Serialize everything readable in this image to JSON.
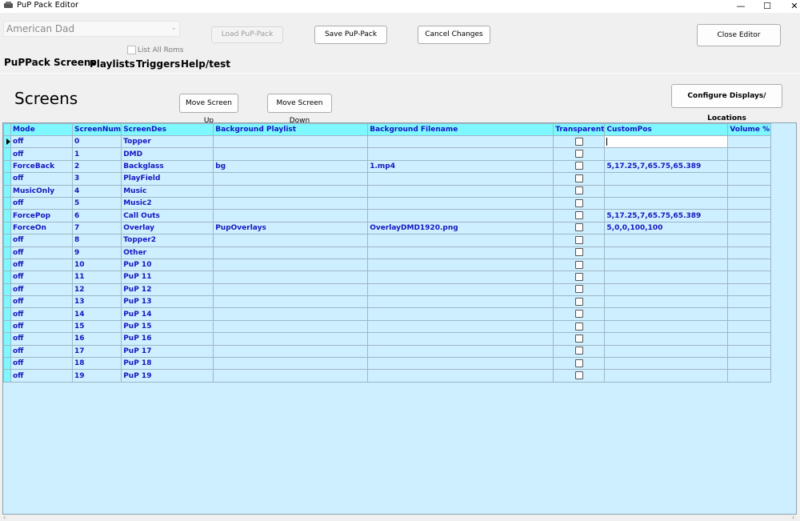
{
  "window": {
    "title": "PuP Pack Editor",
    "minimize": "—",
    "maximize": "☐",
    "close": "✕"
  },
  "toolbar": {
    "rom_selected": "American Dad",
    "list_all_roms": "List All Roms",
    "load_pup_pack": "Load PuP-Pack",
    "save_pup_pack": "Save PuP-Pack",
    "cancel_changes": "Cancel Changes",
    "close_editor": "Close Editor"
  },
  "tabs": [
    "PuPPack Screens",
    "Playlists",
    "Triggers",
    "Help/test"
  ],
  "screens": {
    "title": "Screens",
    "move_up": "Move Screen Up",
    "move_down": "Move Screen Down",
    "configure_displays": "Configure Displays/ Locations"
  },
  "grid": {
    "columns": [
      "Mode",
      "ScreenNum",
      "ScreenDes",
      "Background Playlist",
      "Background Filename",
      "Transparent",
      "CustomPos",
      "Volume %"
    ],
    "rows": [
      {
        "mode": "off",
        "num": "0",
        "des": "Topper",
        "playlist": "",
        "filename": "",
        "transparent": false,
        "custompos": "",
        "volume": ""
      },
      {
        "mode": "off",
        "num": "1",
        "des": "DMD",
        "playlist": "",
        "filename": "",
        "transparent": false,
        "custompos": "",
        "volume": ""
      },
      {
        "mode": "ForceBack",
        "num": "2",
        "des": "Backglass",
        "playlist": "bg",
        "filename": "1.mp4",
        "transparent": false,
        "custompos": "5,17.25,7,65.75,65.389",
        "volume": ""
      },
      {
        "mode": "off",
        "num": "3",
        "des": "PlayField",
        "playlist": "",
        "filename": "",
        "transparent": false,
        "custompos": "",
        "volume": ""
      },
      {
        "mode": "MusicOnly",
        "num": "4",
        "des": "Music",
        "playlist": "",
        "filename": "",
        "transparent": false,
        "custompos": "",
        "volume": ""
      },
      {
        "mode": "off",
        "num": "5",
        "des": "Music2",
        "playlist": "",
        "filename": "",
        "transparent": false,
        "custompos": "",
        "volume": ""
      },
      {
        "mode": "ForcePop",
        "num": "6",
        "des": "Call Outs",
        "playlist": "",
        "filename": "",
        "transparent": false,
        "custompos": "5,17.25,7,65.75,65.389",
        "volume": ""
      },
      {
        "mode": "ForceOn",
        "num": "7",
        "des": "Overlay",
        "playlist": "PupOverlays",
        "filename": "OverlayDMD1920.png",
        "transparent": false,
        "custompos": "5,0,0,100,100",
        "volume": ""
      },
      {
        "mode": "off",
        "num": "8",
        "des": "Topper2",
        "playlist": "",
        "filename": "",
        "transparent": false,
        "custompos": "",
        "volume": ""
      },
      {
        "mode": "off",
        "num": "9",
        "des": "Other",
        "playlist": "",
        "filename": "",
        "transparent": false,
        "custompos": "",
        "volume": ""
      },
      {
        "mode": "off",
        "num": "10",
        "des": "PuP 10",
        "playlist": "",
        "filename": "",
        "transparent": false,
        "custompos": "",
        "volume": ""
      },
      {
        "mode": "off",
        "num": "11",
        "des": "PuP 11",
        "playlist": "",
        "filename": "",
        "transparent": false,
        "custompos": "",
        "volume": ""
      },
      {
        "mode": "off",
        "num": "12",
        "des": "PuP 12",
        "playlist": "",
        "filename": "",
        "transparent": false,
        "custompos": "",
        "volume": ""
      },
      {
        "mode": "off",
        "num": "13",
        "des": "PuP 13",
        "playlist": "",
        "filename": "",
        "transparent": false,
        "custompos": "",
        "volume": ""
      },
      {
        "mode": "off",
        "num": "14",
        "des": "PuP 14",
        "playlist": "",
        "filename": "",
        "transparent": false,
        "custompos": "",
        "volume": ""
      },
      {
        "mode": "off",
        "num": "15",
        "des": "PuP 15",
        "playlist": "",
        "filename": "",
        "transparent": false,
        "custompos": "",
        "volume": ""
      },
      {
        "mode": "off",
        "num": "16",
        "des": "PuP 16",
        "playlist": "",
        "filename": "",
        "transparent": false,
        "custompos": "",
        "volume": ""
      },
      {
        "mode": "off",
        "num": "17",
        "des": "PuP 17",
        "playlist": "",
        "filename": "",
        "transparent": false,
        "custompos": "",
        "volume": ""
      },
      {
        "mode": "off",
        "num": "18",
        "des": "PuP 18",
        "playlist": "",
        "filename": "",
        "transparent": false,
        "custompos": "",
        "volume": ""
      },
      {
        "mode": "off",
        "num": "19",
        "des": "PuP 19",
        "playlist": "",
        "filename": "",
        "transparent": false,
        "custompos": "",
        "volume": ""
      }
    ]
  },
  "colors": {
    "grid_bg": "#cdefff",
    "header_bg": "#7ff7ff",
    "grid_text": "#1616c0"
  }
}
